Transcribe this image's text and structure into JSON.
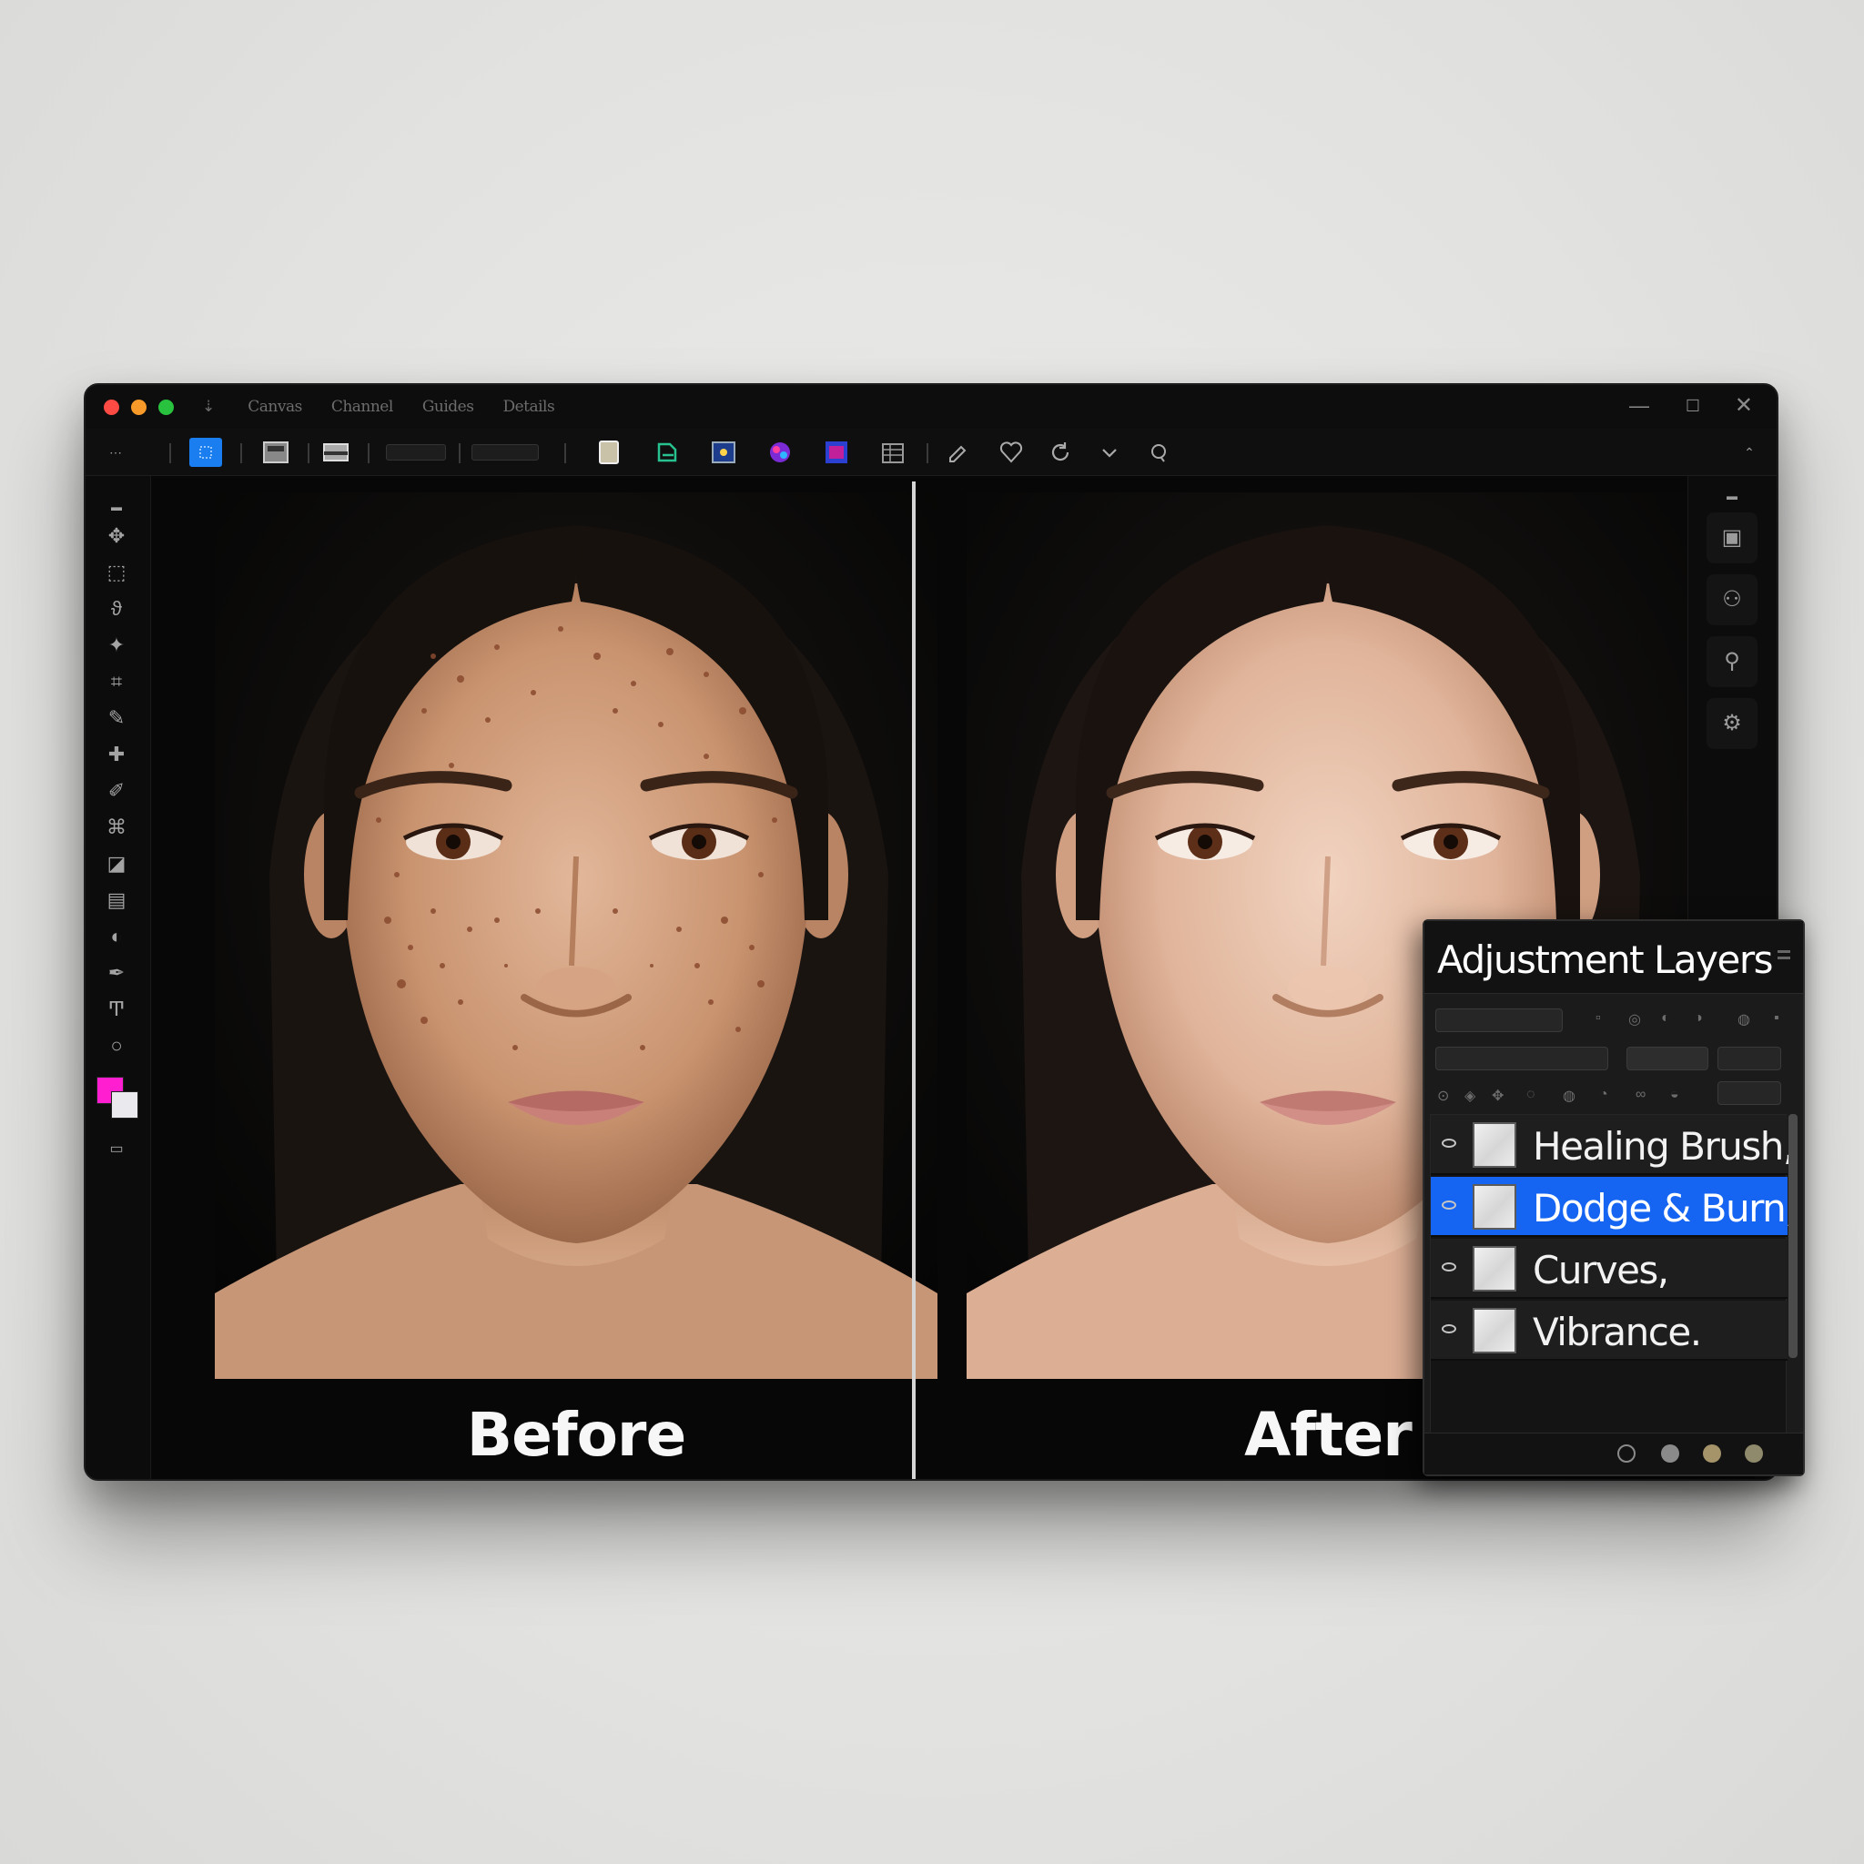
{
  "menu": {
    "first": "⇣",
    "items": [
      "Canvas",
      "Channel",
      "Guides",
      "Details"
    ]
  },
  "window_controls": {
    "minimize": "—",
    "maximize": "☐",
    "close": "✕"
  },
  "toolbar": {
    "icons": [
      "home-icon",
      "select-icon",
      "frame-icon",
      "image-icon",
      "file-icon",
      "export-icon",
      "navigator-icon",
      "swatch-icon",
      "layer-icon",
      "grid-icon",
      "pen-icon",
      "heart-icon",
      "rotate-icon",
      "chevron-icon",
      "circle-icon"
    ]
  },
  "canvas": {
    "before_label": "Before",
    "after_label": "After"
  },
  "colors": {
    "foreground": "#ff1fd0",
    "background": "#e9e9ee",
    "selection": "#1665f2"
  },
  "panel": {
    "title": "Adjustment Layers",
    "layers": [
      {
        "name": "Healing Brush,",
        "selected": false
      },
      {
        "name": "Dodge & Burn,",
        "selected": true
      },
      {
        "name": "Curves,",
        "selected": false
      },
      {
        "name": "Vibrance.",
        "selected": false
      }
    ]
  }
}
